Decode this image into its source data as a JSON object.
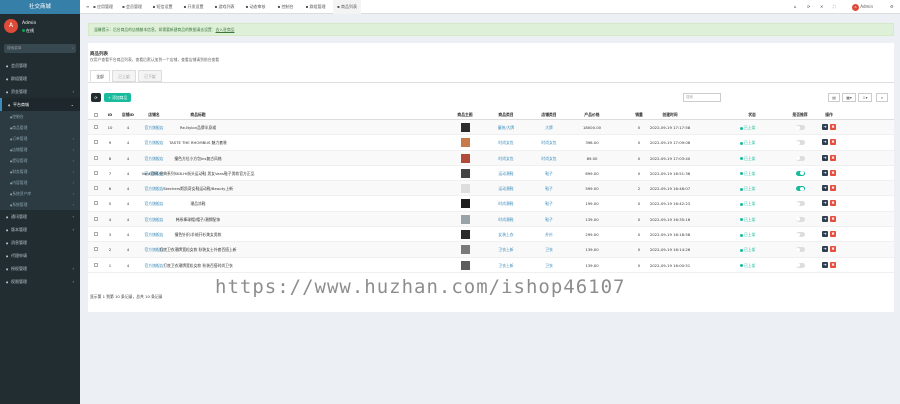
{
  "logo": "社交商城",
  "user": {
    "name": "Admin",
    "status": "在线",
    "avatar": "A"
  },
  "search_placeholder": "搜索菜单",
  "nav": [
    {
      "label": "会员管理",
      "icon": "user-icon",
      "arrow": "",
      "type": "item"
    },
    {
      "label": "群组管理",
      "icon": "group-icon",
      "arrow": "",
      "type": "item"
    },
    {
      "label": "资金管理",
      "icon": "money-icon",
      "arrow": "‹",
      "type": "item"
    },
    {
      "label": "平台商城",
      "icon": "shop-icon",
      "arrow": "⌄",
      "type": "active"
    },
    {
      "label": "控制台",
      "icon": "dashboard-icon",
      "arrow": "",
      "type": "sub"
    },
    {
      "label": "商品管理",
      "icon": "goods-icon",
      "arrow": "",
      "type": "sub"
    },
    {
      "label": "订单管理",
      "icon": "order-icon",
      "arrow": "‹",
      "type": "sub"
    },
    {
      "label": "店铺管理",
      "icon": "store-icon",
      "arrow": "‹",
      "type": "sub"
    },
    {
      "label": "提现管理",
      "icon": "withdraw-icon",
      "arrow": "‹",
      "type": "sub"
    },
    {
      "label": "财务管理",
      "icon": "finance-icon",
      "arrow": "‹",
      "type": "sub"
    },
    {
      "label": "内容管理",
      "icon": "content-icon",
      "arrow": "‹",
      "type": "sub"
    },
    {
      "label": "系统资产库",
      "icon": "asset-icon",
      "arrow": "‹",
      "type": "sub"
    },
    {
      "label": "系统管理",
      "icon": "system-icon",
      "arrow": "‹",
      "type": "sub"
    },
    {
      "label": "通讯管理",
      "icon": "chat-icon",
      "arrow": "‹",
      "type": "item"
    },
    {
      "label": "版本管理",
      "icon": "version-icon",
      "arrow": "‹",
      "type": "item"
    },
    {
      "label": "消息管理",
      "icon": "message-icon",
      "arrow": "",
      "type": "item"
    },
    {
      "label": "代理申请",
      "icon": "agent-icon",
      "arrow": "",
      "type": "item"
    },
    {
      "label": "授权管理",
      "icon": "auth-icon",
      "arrow": "‹",
      "type": "item"
    },
    {
      "label": "权限管理",
      "icon": "permission-icon",
      "arrow": "‹",
      "type": "item"
    }
  ],
  "topbar": {
    "menu_icon": "≡",
    "items": [
      "应用管理",
      "会员管理",
      "短信设置",
      "开发设置",
      "游戏列表",
      "动态审核",
      "控制台",
      "群组管理",
      "商品列表"
    ],
    "admin": "Admin"
  },
  "alert": {
    "text": "温馨提示：后台商品的店铺基本信息，如需要新建商品的数据请去设置：",
    "link": "去入驻商品"
  },
  "panel": {
    "title": "商品列表",
    "subtitle": "仅用户查看平台商品列表，查看后默认加到一个店铺，查看店铺请到前台查看",
    "tabs": [
      "全部",
      "已上架",
      "已下架"
    ],
    "add_label": "+ 添加商品",
    "refresh_icon": "⟳",
    "search_placeholder": "搜索"
  },
  "columns": [
    "ID",
    "店铺ID",
    "店铺名",
    "商品标题",
    "商品主图",
    "商品类目",
    "店铺类目",
    "产品价格",
    "销量",
    "创建时间",
    "状态",
    "是否推荐",
    "操作"
  ],
  "rows": [
    {
      "id": "10",
      "shop_id": "4",
      "shop": "官方旗舰店",
      "title": "Re-Nylon品牌半身裙",
      "cat": "童装/大牌",
      "shop_cat": "大牌",
      "price": "18000.00",
      "sales": "0",
      "time": "2022-09-19 17:17:58",
      "status": "已上架",
      "rec": false,
      "img": "#2b2b2b"
    },
    {
      "id": "9",
      "shop_id": "4",
      "shop": "官方旗舰店",
      "title": "TASTE THE RHOMBUS 魅力套装",
      "cat": "时尚女包",
      "shop_cat": "时尚女包",
      "price": "398.00",
      "sales": "0",
      "time": "2022-09-19 17:09:06",
      "status": "已上架",
      "rec": false,
      "img": "#c77a4a"
    },
    {
      "id": "8",
      "shop_id": "4",
      "shop": "官方旗舰店",
      "title": "撞色方位小方包Ins复古风格",
      "cat": "时尚女包",
      "shop_cat": "时尚女包",
      "price": "89.00",
      "sales": "0",
      "time": "2022-09-19 17:03:40",
      "status": "已上架",
      "rec": false,
      "img": "#b24a3a"
    },
    {
      "id": "7",
      "shop_id": "4",
      "shop": "官方旗舰店",
      "title": "Vans官网 经典系列SK8-Hi街头运动鞋 男女Vans鞋子男款官方正品",
      "cat": "运动潮鞋",
      "shop_cat": "鞋子",
      "price": "699.00",
      "sales": "0",
      "time": "2022-09-19 16:51:36",
      "status": "已上架",
      "rec": true,
      "img": "#444444"
    },
    {
      "id": "6",
      "shop_id": "4",
      "shop": "官方旗舰店",
      "title": "Skechers斯凯奇女鞋运动鞋/Beauty上新",
      "cat": "运动潮鞋",
      "shop_cat": "鞋子",
      "price": "599.00",
      "sales": "2",
      "time": "2022-09-19 16:48:07",
      "status": "已上架",
      "rec": true,
      "img": "#dedede"
    },
    {
      "id": "5",
      "shop_id": "4",
      "shop": "官方旗舰店",
      "title": "潮品凉鞋",
      "cat": "时尚潮鞋",
      "shop_cat": "鞋子",
      "price": "199.00",
      "sales": "0",
      "time": "2022-09-19 16:42:23",
      "status": "已上架",
      "rec": false,
      "img": "#1e1e1e"
    },
    {
      "id": "4",
      "shop_id": "4",
      "shop": "官方旗舰店",
      "title": "韩系棒球帽/帽子/潮牌配饰",
      "cat": "时尚潮鞋",
      "shop_cat": "鞋子",
      "price": "139.00",
      "sales": "0",
      "time": "2022-09-19 16:35:16",
      "status": "已上架",
      "rec": false,
      "img": "#9aa3a8"
    },
    {
      "id": "3",
      "shop_id": "4",
      "shop": "官方旗舰店",
      "title": "撞色针织/羊绒开衫美女男款",
      "cat": "女装上衣",
      "shop_cat": "外衫",
      "price": "299.00",
      "sales": "0",
      "time": "2022-09-19 16:18:58",
      "status": "已上架",
      "rec": false,
      "img": "#2a2a2a"
    },
    {
      "id": "2",
      "shop_id": "4",
      "shop": "官方旗舰店",
      "title": "打底卫衣潮牌宽松女款 秋装女士外套百搭上新",
      "cat": "卫衣上新",
      "shop_cat": "卫衣",
      "price": "139.00",
      "sales": "0",
      "time": "2022-09-19 16:14:26",
      "status": "已上架",
      "rec": false,
      "img": "#7a7a7a"
    },
    {
      "id": "1",
      "shop_id": "4",
      "shop": "官方旗舰店",
      "title": "打底卫衣潮牌宽松女款 秋装百搭时尚卫衣",
      "cat": "卫衣上新",
      "shop_cat": "卫衣",
      "price": "139.00",
      "sales": "0",
      "time": "2022-09-19 16:00:51",
      "status": "已上架",
      "rec": false,
      "img": "#5c5c5c"
    }
  ],
  "footer": "显示第 1 到第 10 条记录，总共 10 条记录",
  "watermark": "https://www.huzhan.com/ishop46107",
  "colors": {
    "sidebar": "#222d32",
    "accent": "#3c8dbc",
    "green": "#18bc9c",
    "red": "#e74c3c"
  }
}
